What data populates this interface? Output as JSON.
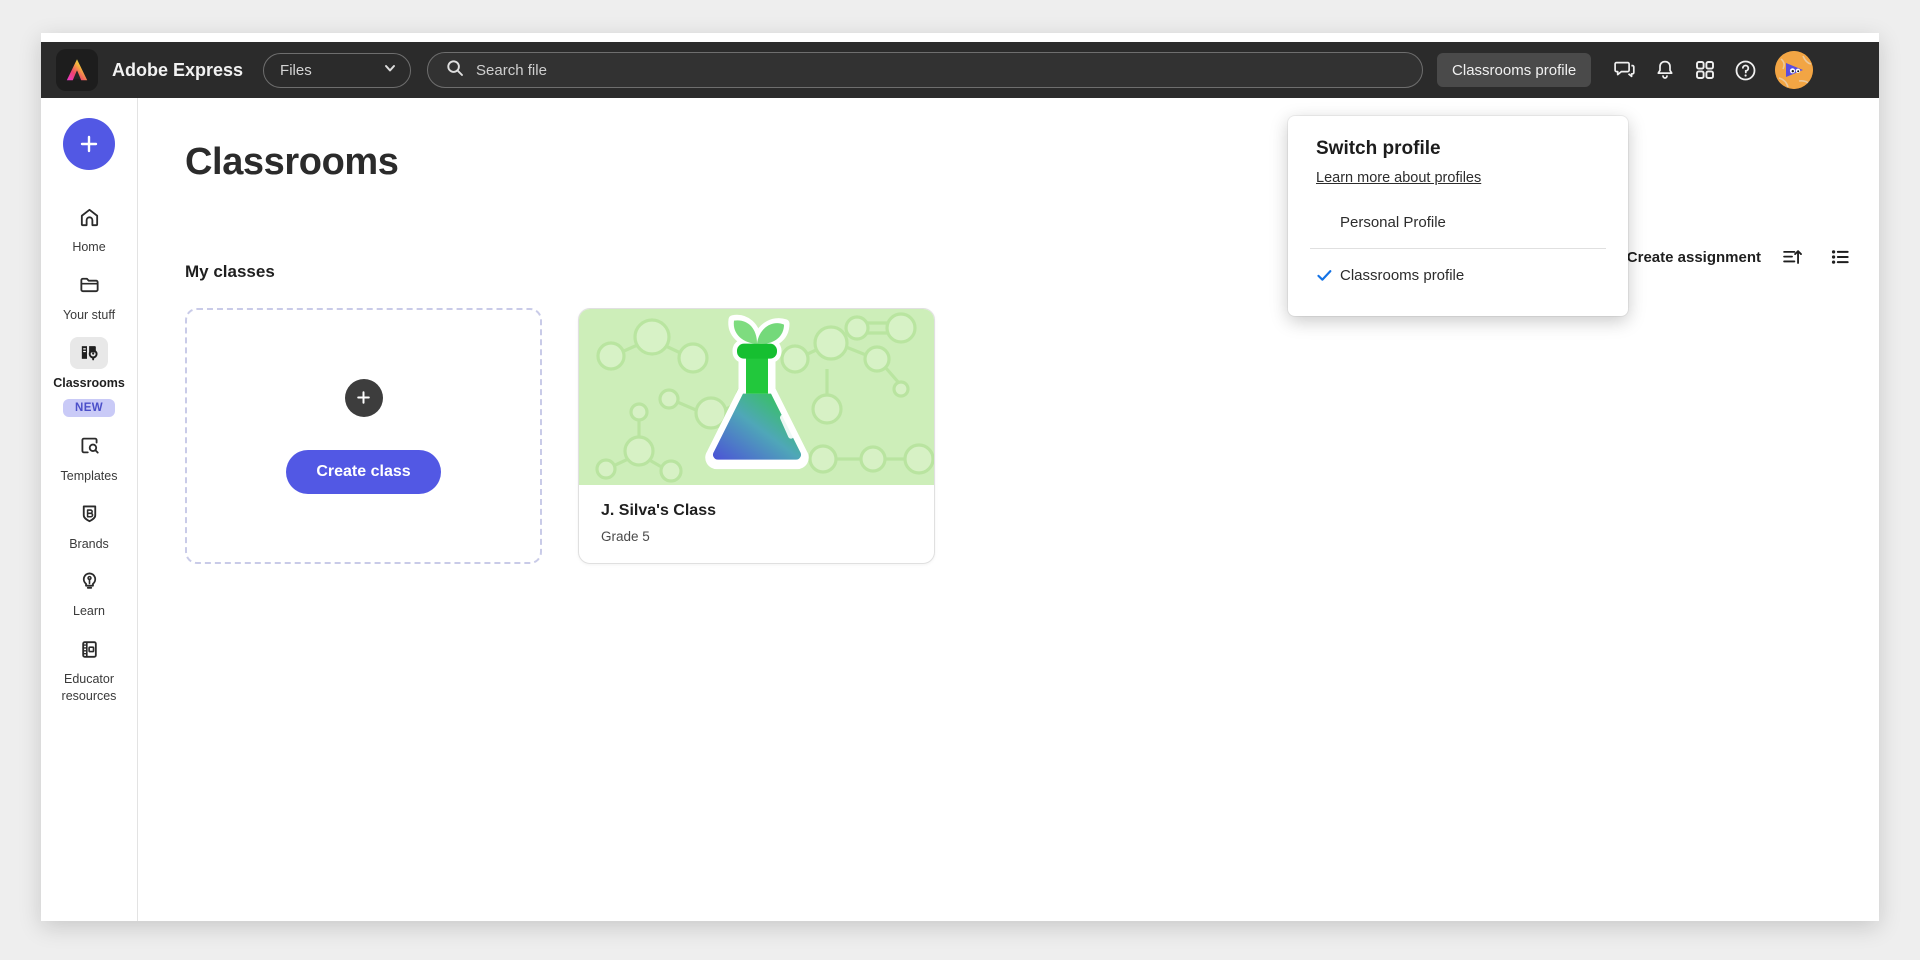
{
  "topbar": {
    "brand_name": "Adobe Express",
    "files_select_value": "Files",
    "search_placeholder": "Search file",
    "profile_chip_label": "Classrooms profile",
    "icons": [
      "chat-icon",
      "bell-icon",
      "apps-grid-icon",
      "help-icon",
      "avatar"
    ]
  },
  "sidebar": {
    "create_label": "+",
    "items": [
      {
        "label": "Home",
        "icon": "home-icon",
        "active": false,
        "badge": null
      },
      {
        "label": "Your stuff",
        "icon": "folder-icon",
        "active": false,
        "badge": null
      },
      {
        "label": "Classrooms",
        "icon": "classrooms-icon",
        "active": true,
        "badge": "NEW"
      },
      {
        "label": "Templates",
        "icon": "templates-search-icon",
        "active": false,
        "badge": null
      },
      {
        "label": "Brands",
        "icon": "brands-shield-icon",
        "active": false,
        "badge": null
      },
      {
        "label": "Learn",
        "icon": "lightbulb-icon",
        "active": false,
        "badge": null
      },
      {
        "label": "Educator resources",
        "icon": "notebook-icon",
        "active": false,
        "badge": null
      }
    ]
  },
  "main": {
    "page_title": "Classrooms",
    "section_title": "My classes",
    "create_assignment_label": "Create assignment",
    "sort_icon": "sort-ascending-icon",
    "view_icon": "list-view-icon",
    "create_class_tile": {
      "plus_icon": "plus-icon",
      "button_label": "Create class"
    },
    "classes": [
      {
        "name": "J. Silva's Class",
        "grade": "Grade 5",
        "thumb_icon": "science-flask-plant-icon",
        "thumb_bg": "#cdeeb9"
      }
    ]
  },
  "profile_dropdown": {
    "title": "Switch profile",
    "learn_more_label": "Learn more about profiles",
    "options": [
      {
        "label": "Personal Profile",
        "selected": false
      },
      {
        "label": "Classrooms profile",
        "selected": true
      }
    ],
    "check_icon": "check-icon"
  },
  "colors": {
    "accent": "#5258e4",
    "topbar_bg": "#2b2b2b",
    "badge_bg": "#c9caf7",
    "badge_text": "#4b4fc9",
    "check_blue": "#1473e6",
    "thumb_green": "#cdeeb9"
  }
}
